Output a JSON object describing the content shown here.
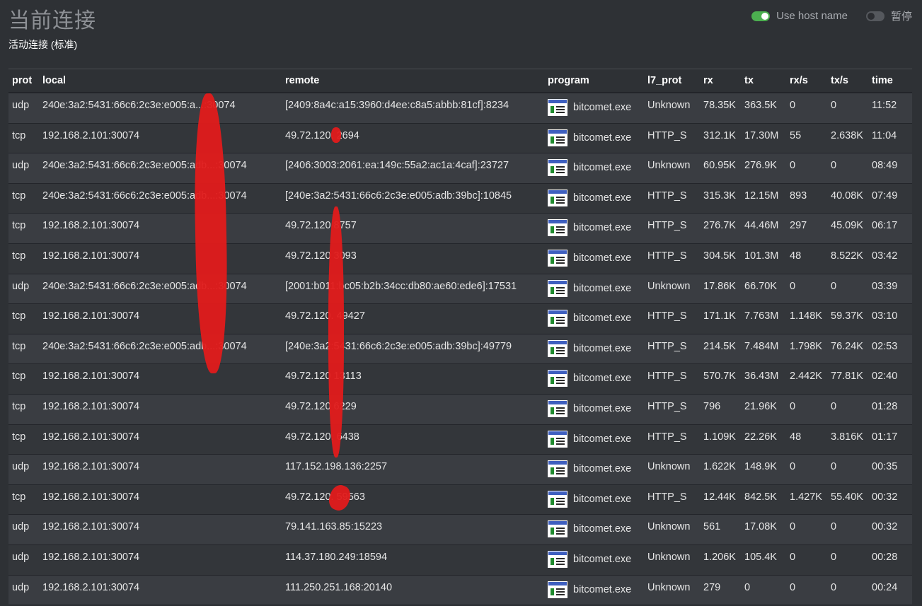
{
  "header": {
    "title": "当前连接",
    "subtitle": "活动连接 (标准)",
    "use_host_name_label": "Use host name",
    "pause_label": "暂停"
  },
  "columns": {
    "prot": "prot",
    "local": "local",
    "remote": "remote",
    "program": "program",
    "l7_prot": "l7_prot",
    "rx": "rx",
    "tx": "tx",
    "rx_s": "rx/s",
    "tx_s": "tx/s",
    "time": "time"
  },
  "rows": [
    {
      "prot": "udp",
      "local": "240e:3a2:5431:66c6:2c3e:e005:a...:30074",
      "remote": "[2409:8a4c:a15:3960:d4ee:c8a5:abbb:81cf]:8234",
      "program": "bitcomet.exe",
      "l7": "Unknown",
      "rx": "78.35K",
      "tx": "363.5K",
      "rxs": "0",
      "txs": "0",
      "time": "11:52"
    },
    {
      "prot": "tcp",
      "local": "192.168.2.101:30074",
      "remote": "49.72.120.  2694",
      "program": "bitcomet.exe",
      "l7": "HTTP_S",
      "rx": "312.1K",
      "tx": "17.30M",
      "rxs": "55",
      "txs": "2.638K",
      "time": "11:04"
    },
    {
      "prot": "udp",
      "local": "240e:3a2:5431:66c6:2c3e:e005:adb...:30074",
      "remote": "[2406:3003:2061:ea:149c:55a2:ac1a:4caf]:23727",
      "program": "bitcomet.exe",
      "l7": "Unknown",
      "rx": "60.95K",
      "tx": "276.9K",
      "rxs": "0",
      "txs": "0",
      "time": "08:49"
    },
    {
      "prot": "tcp",
      "local": "240e:3a2:5431:66c6:2c3e:e005:adb...:30074",
      "remote": "[240e:3a2:5431:66c6:2c3e:e005:adb:39bc]:10845",
      "program": "bitcomet.exe",
      "l7": "HTTP_S",
      "rx": "315.3K",
      "tx": "12.15M",
      "rxs": "893",
      "txs": "40.08K",
      "time": "07:49"
    },
    {
      "prot": "tcp",
      "local": "192.168.2.101:30074",
      "remote": "49.72.120  8757",
      "program": "bitcomet.exe",
      "l7": "HTTP_S",
      "rx": "276.7K",
      "tx": "44.46M",
      "rxs": "297",
      "txs": "45.09K",
      "time": "06:17"
    },
    {
      "prot": "tcp",
      "local": "192.168.2.101:30074",
      "remote": "49.72.120  3093",
      "program": "bitcomet.exe",
      "l7": "HTTP_S",
      "rx": "304.5K",
      "tx": "101.3M",
      "rxs": "48",
      "txs": "8.522K",
      "time": "03:42"
    },
    {
      "prot": "udp",
      "local": "240e:3a2:5431:66c6:2c3e:e005:adb...:30074",
      "remote": "[2001:b011:bc05:b2b:34cc:db80:ae60:ede6]:17531",
      "program": "bitcomet.exe",
      "l7": "Unknown",
      "rx": "17.86K",
      "tx": "66.70K",
      "rxs": "0",
      "txs": "0",
      "time": "03:39"
    },
    {
      "prot": "tcp",
      "local": "192.168.2.101:30074",
      "remote": "49.72.120.  49427",
      "program": "bitcomet.exe",
      "l7": "HTTP_S",
      "rx": "171.1K",
      "tx": "7.763M",
      "rxs": "1.148K",
      "txs": "59.37K",
      "time": "03:10"
    },
    {
      "prot": "tcp",
      "local": "240e:3a2:5431:66c6:2c3e:e005:adb...:30074",
      "remote": "[240e:3a2:5431:66c6:2c3e:e005:adb:39bc]:49779",
      "program": "bitcomet.exe",
      "l7": "HTTP_S",
      "rx": "214.5K",
      "tx": "7.484M",
      "rxs": "1.798K",
      "txs": "76.24K",
      "time": "02:53"
    },
    {
      "prot": "tcp",
      "local": "192.168.2.101:30074",
      "remote": "49.72.120  13113",
      "program": "bitcomet.exe",
      "l7": "HTTP_S",
      "rx": "570.7K",
      "tx": "36.43M",
      "rxs": "2.442K",
      "txs": "77.81K",
      "time": "02:40"
    },
    {
      "prot": "tcp",
      "local": "192.168.2.101:30074",
      "remote": "49.72.120  6229",
      "program": "bitcomet.exe",
      "l7": "HTTP_S",
      "rx": "796",
      "tx": "21.96K",
      "rxs": "0",
      "txs": "0",
      "time": "01:28"
    },
    {
      "prot": "tcp",
      "local": "192.168.2.101:30074",
      "remote": "49.72.120.  6438",
      "program": "bitcomet.exe",
      "l7": "HTTP_S",
      "rx": "1.109K",
      "tx": "22.26K",
      "rxs": "48",
      "txs": "3.816K",
      "time": "01:17"
    },
    {
      "prot": "udp",
      "local": "192.168.2.101:30074",
      "remote": "117.152.198.136:2257",
      "program": "bitcomet.exe",
      "l7": "Unknown",
      "rx": "1.622K",
      "tx": "148.9K",
      "rxs": "0",
      "txs": "0",
      "time": "00:35"
    },
    {
      "prot": "tcp",
      "local": "192.168.2.101:30074",
      "remote": "49.72.120.  59563",
      "program": "bitcomet.exe",
      "l7": "HTTP_S",
      "rx": "12.44K",
      "tx": "842.5K",
      "rxs": "1.427K",
      "txs": "55.40K",
      "time": "00:32"
    },
    {
      "prot": "udp",
      "local": "192.168.2.101:30074",
      "remote": "79.141.163.85:15223",
      "program": "bitcomet.exe",
      "l7": "Unknown",
      "rx": "561",
      "tx": "17.08K",
      "rxs": "0",
      "txs": "0",
      "time": "00:32"
    },
    {
      "prot": "udp",
      "local": "192.168.2.101:30074",
      "remote": "114.37.180.249:18594",
      "program": "bitcomet.exe",
      "l7": "Unknown",
      "rx": "1.206K",
      "tx": "105.4K",
      "rxs": "0",
      "txs": "0",
      "time": "00:28"
    },
    {
      "prot": "udp",
      "local": "192.168.2.101:30074",
      "remote": "111.250.251.168:20140",
      "program": "bitcomet.exe",
      "l7": "Unknown",
      "rx": "279",
      "tx": "0",
      "rxs": "0",
      "txs": "0",
      "time": "00:24"
    }
  ],
  "colors": {
    "toggle_on": "#4caf50",
    "redaction": "#e11b1b",
    "program_icon": "application-window-icon"
  }
}
